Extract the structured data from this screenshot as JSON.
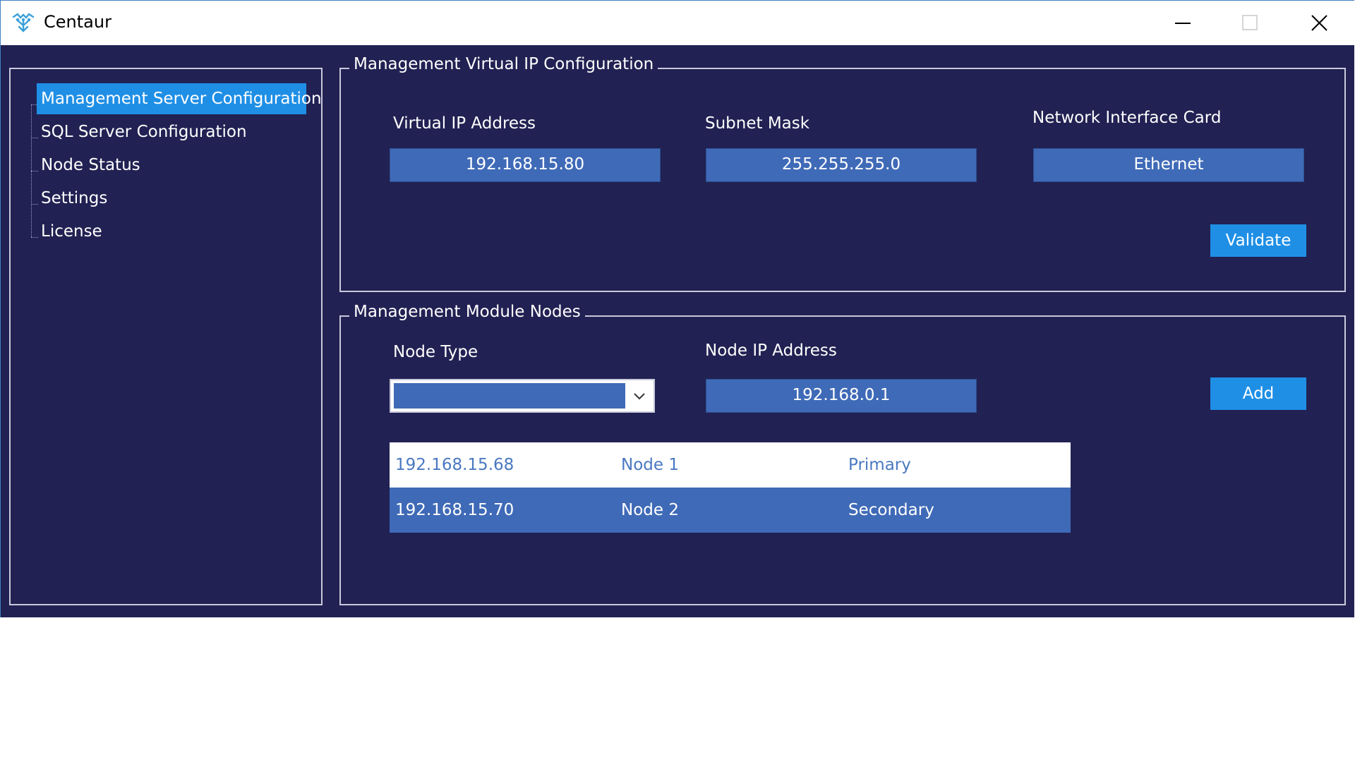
{
  "window": {
    "title": "Centaur",
    "icon": "centaur-logo-icon",
    "controls": [
      "minimize-icon",
      "maximize-icon",
      "close-icon"
    ]
  },
  "sidebar": {
    "items": [
      {
        "label": "Management Server Configuration",
        "selected": true
      },
      {
        "label": "SQL Server Configuration",
        "selected": false
      },
      {
        "label": "Node Status",
        "selected": false
      },
      {
        "label": "Settings",
        "selected": false
      },
      {
        "label": "License",
        "selected": false
      }
    ]
  },
  "vip_config": {
    "title": "Management Virtual IP Configuration",
    "virtual_ip_label": "Virtual IP Address",
    "virtual_ip_value": "192.168.15.80",
    "subnet_label": "Subnet Mask",
    "subnet_value": "255.255.255.0",
    "nic_label": "Network Interface Card",
    "nic_value": "Ethernet",
    "validate_label": "Validate"
  },
  "nodes": {
    "title": "Management Module Nodes",
    "node_type_label": "Node Type",
    "node_type_value": "",
    "node_ip_label": "Node IP Address",
    "node_ip_value": "192.168.0.1",
    "add_label": "Add",
    "rows": [
      {
        "ip": "192.168.15.68",
        "name": "Node 1",
        "role": "Primary"
      },
      {
        "ip": "192.168.15.70",
        "name": "Node 2",
        "role": "Secondary"
      }
    ]
  },
  "colors": {
    "background": "#212153",
    "accent": "#1f8fe6",
    "field": "#3f6ab7"
  }
}
